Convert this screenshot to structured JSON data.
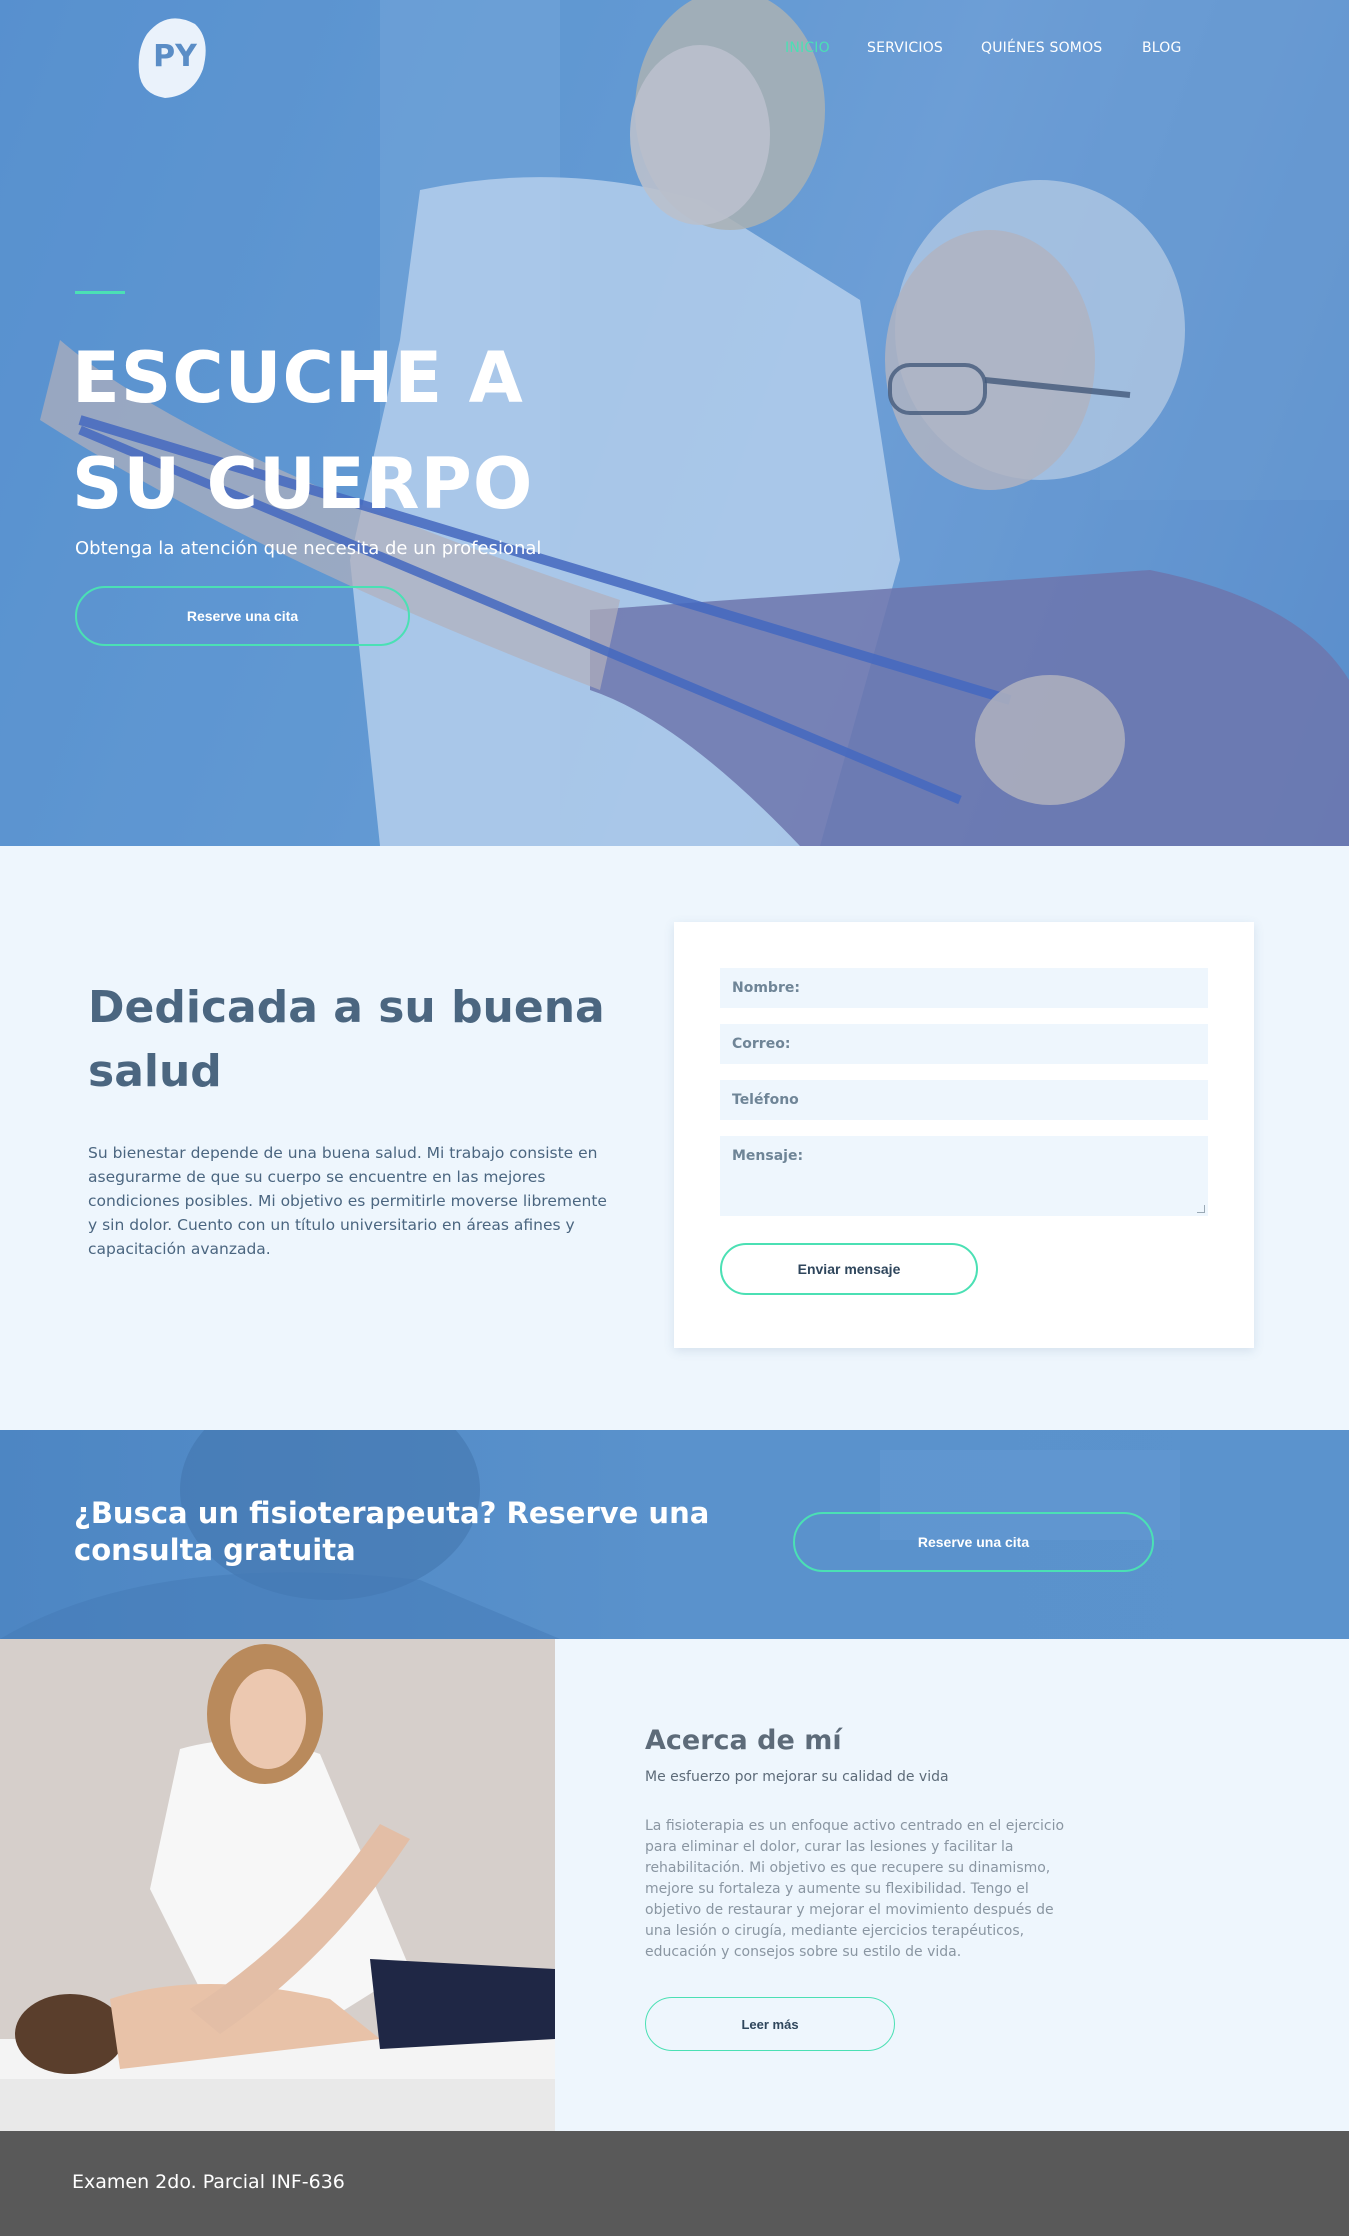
{
  "brand": {
    "logo_text": "PY"
  },
  "nav": {
    "items": [
      {
        "label": "INICIO",
        "active": true
      },
      {
        "label": "SERVICIOS",
        "active": false
      },
      {
        "label": "QUIÉNES SOMOS",
        "active": false
      },
      {
        "label": "BLOG",
        "active": false
      }
    ]
  },
  "hero": {
    "title_line1": "ESCUCHE A",
    "title_line2": "SU CUERPO",
    "subtitle": "Obtenga la atención que necesita de un profesional",
    "button": "Reserve una cita"
  },
  "dedicated": {
    "title": "Dedicada a su buena salud",
    "text": "Su bienestar depende de una buena salud. Mi trabajo consiste en asegurarme de que su cuerpo se encuentre en las mejores condiciones posibles.  Mi objetivo es permitirle moverse libremente y sin dolor. Cuento con un título universitario en áreas afines y capacitación avanzada."
  },
  "form": {
    "name_placeholder": "Nombre:",
    "email_placeholder": "Correo:",
    "phone_placeholder": "Teléfono",
    "message_placeholder": "Mensaje:",
    "submit": "Enviar mensaje"
  },
  "cta": {
    "title": "¿Busca un fisioterapeuta? Reserve una consulta gratuita",
    "button": "Reserve una cita"
  },
  "about": {
    "title": "Acerca de mí",
    "subtitle": "Me esfuerzo por mejorar su calidad de vida",
    "text": "La fisioterapia es un enfoque activo centrado en el ejercicio para eliminar el dolor, curar las lesiones y facilitar la rehabilitación. Mi objetivo es que recupere su dinamismo, mejore su fortaleza y aumente su flexibilidad. Tengo el objetivo de restaurar y mejorar el movimiento después de una lesión o cirugía, mediante ejercicios terapéuticos, educación y consejos sobre su estilo de vida.",
    "button": "Leer más"
  },
  "footer": {
    "text": "Examen 2do. Parcial INF-636"
  },
  "colors": {
    "accent": "#4be0b4",
    "hero_blue": "#5a93cf",
    "heading": "#4b6680",
    "footer": "#595959"
  }
}
